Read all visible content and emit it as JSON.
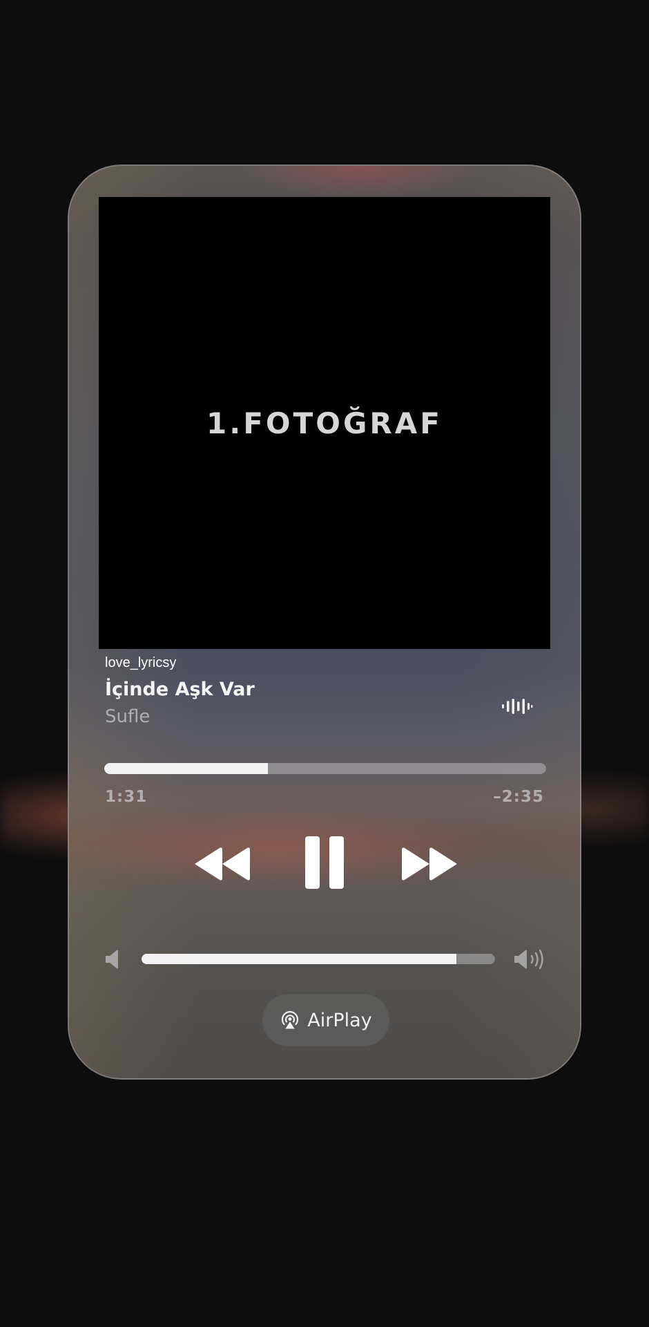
{
  "artwork": {
    "text": "1.FOTOĞRAF"
  },
  "overlay": {
    "watermark": "love_lyricsy"
  },
  "track": {
    "title": "İçinde Aşk Var",
    "artist": "Sufle"
  },
  "playback": {
    "elapsed": "1:31",
    "remaining": "–2:35",
    "progress_fraction": 0.37,
    "state": "playing"
  },
  "volume": {
    "level_fraction": 0.89
  },
  "airplay": {
    "label": "AirPlay"
  },
  "icons": {
    "waveform": "waveform-icon",
    "rewind": "rewind-icon",
    "pause": "pause-icon",
    "forward": "fast-forward-icon",
    "volume_low": "speaker-low-icon",
    "volume_high": "speaker-high-icon",
    "airplay": "airplay-icon"
  },
  "colors": {
    "background": "#0d0d0e",
    "controls": "#ffffff",
    "track_fill": "#f2f2f2"
  }
}
